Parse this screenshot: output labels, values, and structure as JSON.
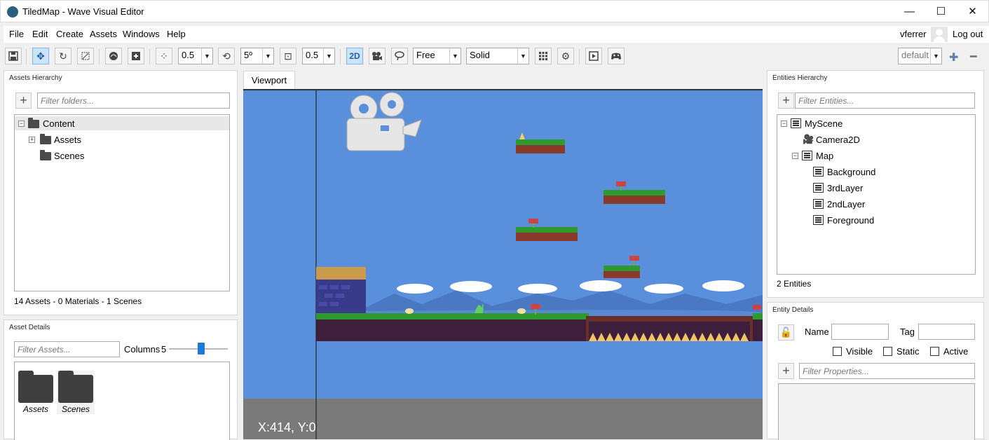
{
  "window": {
    "title": "TiledMap - Wave Visual Editor",
    "minimize": "—",
    "maximize": "☐",
    "close": "✕"
  },
  "menu": {
    "items": [
      "File",
      "Edit",
      "Create",
      "Assets",
      "Windows",
      "Help"
    ],
    "user": "vferrer",
    "logout": "Log out"
  },
  "toolbar": {
    "snap_value": "0.5",
    "rotation_value": "5º",
    "scale_value": "0.5",
    "mode_2d": "2D",
    "projection": "Free",
    "render_mode": "Solid",
    "profile": "default",
    "icons": [
      "save-icon",
      "move-icon",
      "rotate-icon",
      "scale-icon",
      "sphere-icon",
      "add-entity-icon",
      "snap-move-icon",
      "snap-rotate-icon",
      "snap-scale-icon",
      "camera-icon",
      "lasso-icon",
      "grid-icon",
      "settings-icon",
      "play-icon",
      "gamepad-icon",
      "add-icon",
      "remove-icon"
    ]
  },
  "assets_hierarchy": {
    "title": "Assets Hierarchy",
    "filter_placeholder": "Filter folders...",
    "tree": [
      {
        "label": "Content"
      },
      {
        "label": "Assets"
      },
      {
        "label": "Scenes"
      }
    ],
    "status": "14 Assets - 0 Materials - 1 Scenes"
  },
  "asset_details": {
    "title": "Asset Details",
    "filter_placeholder": "Filter Assets...",
    "columns_label": "Columns",
    "columns_value": "5",
    "columns_slider_fraction": 0.55,
    "items": [
      {
        "label": "Assets"
      },
      {
        "label": "Scenes"
      }
    ]
  },
  "viewport": {
    "tab": "Viewport",
    "coords": "X:414, Y:0",
    "sky_color": "#5a8fdc",
    "ground_color": "#3d1f3c"
  },
  "entities_hierarchy": {
    "title": "Entities Hierarchy",
    "filter_placeholder": "Filter Entities...",
    "tree": [
      {
        "label": "MyScene"
      },
      {
        "label": "Camera2D"
      },
      {
        "label": "Map"
      },
      {
        "label": "Background"
      },
      {
        "label": "3rdLayer"
      },
      {
        "label": "2ndLayer"
      },
      {
        "label": "Foreground"
      }
    ],
    "status": "2 Entities"
  },
  "entity_details": {
    "title": "Entity Details",
    "name_label": "Name",
    "tag_label": "Tag",
    "visible_label": "Visible",
    "static_label": "Static",
    "active_label": "Active",
    "filter_placeholder": "Filter Properties..."
  }
}
